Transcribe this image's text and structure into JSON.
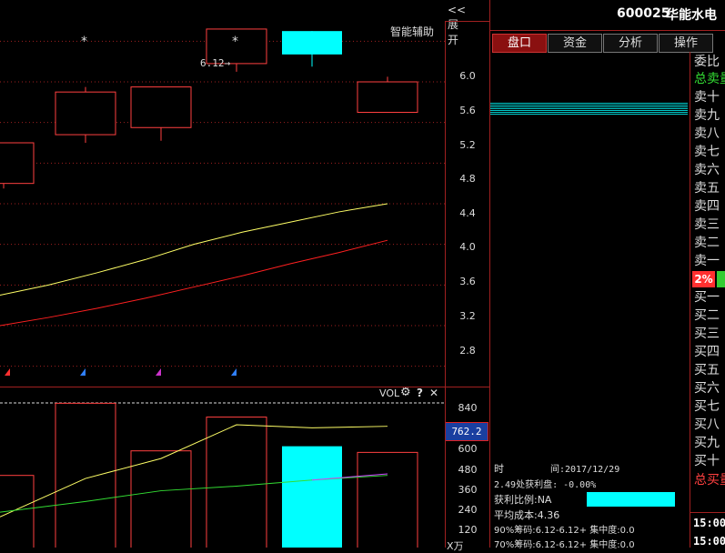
{
  "chart_toolbar": {
    "expand_label": "<<展开",
    "assist_label": "智能辅助",
    "markers": [
      "*",
      "*"
    ],
    "price_annotation": "6.12→"
  },
  "price_axis": {
    "ticks": [
      "6.0",
      "5.6",
      "5.2",
      "4.8",
      "4.4",
      "4.0",
      "3.6",
      "3.2",
      "2.8"
    ]
  },
  "volume_toolbar": {
    "indicator_label": "VOL",
    "help_label": "?",
    "close_label": "✕"
  },
  "volume_axis": {
    "ticks": [
      "840",
      "600",
      "480",
      "360",
      "240",
      "120"
    ],
    "current_value": "762.2",
    "unit_label": "X万"
  },
  "stock": {
    "code": "600025",
    "name": "华能水电"
  },
  "tabs": [
    {
      "label": "盘口",
      "active": true
    },
    {
      "label": "资金",
      "active": false
    },
    {
      "label": "分析",
      "active": false
    },
    {
      "label": "操作",
      "active": false
    }
  ],
  "chip_info": {
    "date_label": "时",
    "date_value": "间:2017/12/29",
    "profit_line": "2.49处获利盘: -0.00%",
    "profit_ratio": "获利比例:NA",
    "avg_cost": "平均成本:4.36",
    "chip90": "90%筹码:6.12-6.12+ 集中度:0.0",
    "chip70": "70%筹码:6.12-6.12+ 集中度:0.0"
  },
  "order_book": {
    "ratio_label": "委比",
    "total_sell_label": "总卖量",
    "sell_levels": [
      "卖十",
      "卖九",
      "卖八",
      "卖七",
      "卖六",
      "卖五",
      "卖四",
      "卖三",
      "卖二",
      "卖一"
    ],
    "percent_badge": "2%",
    "buy_levels": [
      "买一",
      "买二",
      "买三",
      "买四",
      "买五",
      "买六",
      "买七",
      "买八",
      "买九",
      "买十"
    ],
    "total_buy_label": "总买量"
  },
  "time_labels": [
    "15:00",
    "15:00"
  ],
  "colors": {
    "up_candle": "#ff4040",
    "down_candle": "#00ffff",
    "ma_short": "#ffff66",
    "ma_long": "#ff2020",
    "vol_ma_short": "#ffff66",
    "vol_ma_mid": "#33dd33",
    "vol_ma_long": "#cc44ff",
    "active_tab": "#8a1010",
    "value_box": "#1a3fa0"
  },
  "chart_data": [
    {
      "type": "candlestick",
      "ylim": [
        2.6,
        6.2
      ],
      "candles": [
        {
          "open": 4.6,
          "close": 5.0,
          "high": 5.0,
          "low": 4.55
        },
        {
          "open": 5.08,
          "close": 5.5,
          "high": 5.55,
          "low": 5.0
        },
        {
          "open": 5.15,
          "close": 5.55,
          "high": 5.55,
          "low": 5.02
        },
        {
          "open": 5.78,
          "close": 6.12,
          "high": 6.12,
          "low": 5.7
        },
        {
          "open": 6.1,
          "close": 5.87,
          "high": 6.1,
          "low": 5.75
        },
        {
          "open": 5.3,
          "close": 5.6,
          "high": 5.65,
          "low": 5.3
        }
      ],
      "ma_short": [
        3.5,
        3.6,
        3.72,
        3.85,
        4.0,
        4.12,
        4.22,
        4.32,
        4.4
      ],
      "ma_long": [
        3.2,
        3.28,
        3.37,
        3.47,
        3.58,
        3.69,
        3.81,
        3.92,
        4.04
      ]
    },
    {
      "type": "bar",
      "ylim": [
        0,
        960
      ],
      "values": [
        470,
        940,
        630,
        850,
        660,
        620
      ],
      "ma_short": [
        200,
        450,
        580,
        800,
        780,
        790
      ],
      "ma_mid": [
        230,
        300,
        370,
        400,
        440,
        470
      ],
      "ma_long": [
        440,
        480
      ]
    }
  ]
}
